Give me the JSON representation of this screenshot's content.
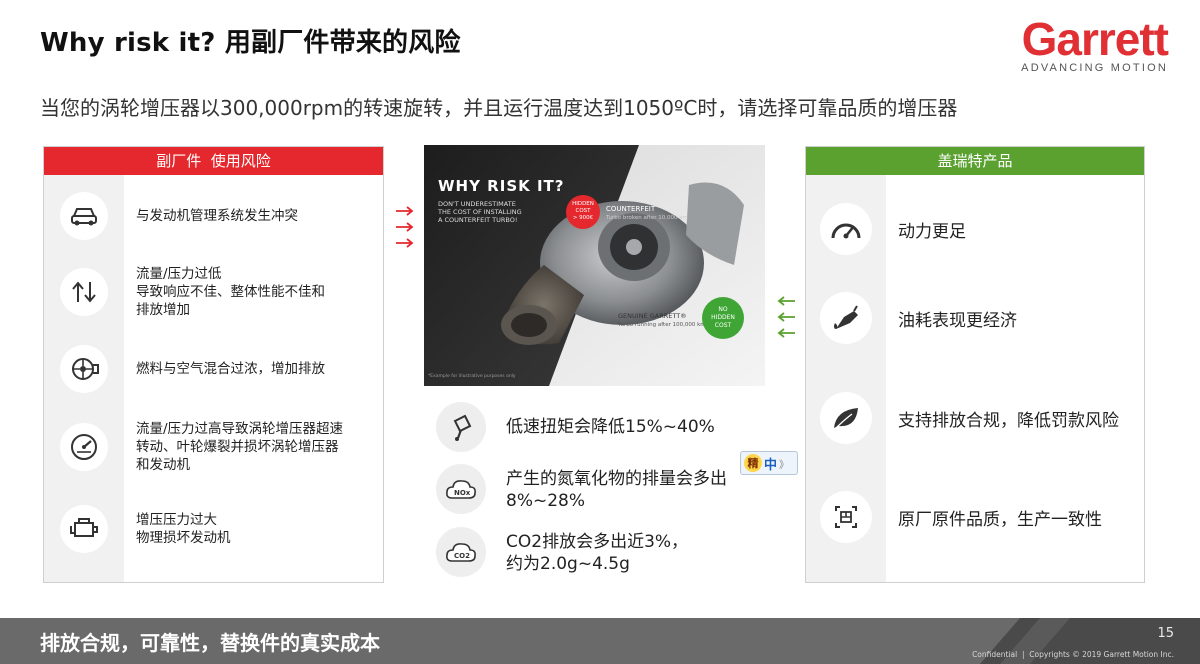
{
  "header": {
    "title": "Why risk it? 用副厂件带来的风险",
    "subtitle": "当您的涡轮增压器以300,000rpm的转速旋转，并且运行温度达到1050ºC时，请选择可靠品质的增压器",
    "logo_word": "Garrett",
    "logo_tagline": "ADVANCING MOTION"
  },
  "left_panel": {
    "heading": "副厂件  使用风险",
    "items": [
      {
        "icon": "car-icon",
        "text": "与发动机管理系统发生冲突"
      },
      {
        "icon": "up-down-arrows-icon",
        "text": "流量/压力过低\n导致响应不佳、整体性能不佳和\n排放增加"
      },
      {
        "icon": "turbo-icon",
        "text": "燃料与空气混合过浓，增加排放"
      },
      {
        "icon": "speedometer-icon",
        "text": "流量/压力过高导致涡轮增压器超速\n转动、叶轮爆裂并损坏涡轮增压器\n和发动机"
      },
      {
        "icon": "engine-icon",
        "text": "增压压力过大\n物理损坏发动机"
      }
    ]
  },
  "center_image": {
    "headline": "WHY RISK IT?",
    "warning": "DON'T UNDERESTIMATE\nTHE COST OF INSTALLING\nA COUNTERFEIT TURBO!",
    "hidden_badge": "HIDDEN\nCOST\n> 900€",
    "counterfeit_label": "COUNTERFEIT",
    "counterfeit_note": "Turbo broken after 10,000 km",
    "genuine_label": "GENUINE GARRETT®",
    "genuine_note": "Turbo running after 100,000 km",
    "no_hidden_badge": "NO\nHIDDEN\nCOST",
    "footnote": "*Example for illustrative purposes only"
  },
  "center_points": [
    {
      "icon": "piston-icon",
      "text": "低速扭矩会降低15%~40%"
    },
    {
      "icon": "nox-cloud-icon",
      "text": "产生的氮氧化物的排量会多出\n8%~28%"
    },
    {
      "icon": "co2-cloud-icon",
      "text": "CO2排放会多出近3%，\n约为2.0g~4.5g"
    }
  ],
  "right_panel": {
    "heading": "盖瑞特产品",
    "items": [
      {
        "icon": "gauge-icon",
        "text": "动力更足"
      },
      {
        "icon": "fuel-nozzle-icon",
        "text": "油耗表现更经济"
      },
      {
        "icon": "leaf-icon",
        "text": "支持排放合规，降低罚款风险"
      },
      {
        "icon": "package-icon",
        "text": "原厂原件品质，生产一致性"
      }
    ]
  },
  "ime": {
    "label_a": "精",
    "label_b": "中",
    "label_c": "》"
  },
  "footer": {
    "text": "排放合规，可靠性，替换件的真实成本",
    "page_number": "15",
    "copyright": "Confidential  |  Copyrights © 2019 Garrett Motion Inc."
  },
  "colors": {
    "red": "#e5282e",
    "green": "#5ba12f",
    "logo_red": "#e03034",
    "footer_gray": "#6a6a6a"
  }
}
